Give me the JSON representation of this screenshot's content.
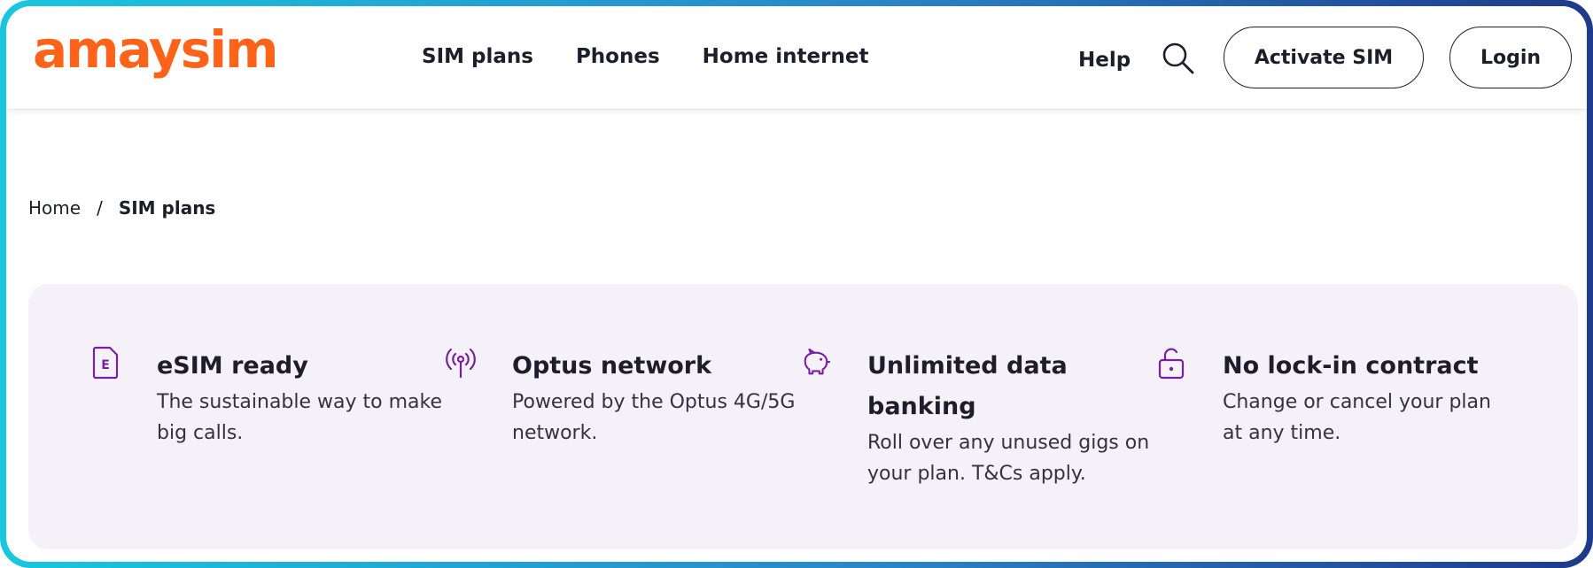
{
  "brand": {
    "logo_text": "amaysim",
    "accent_color": "#ff6319",
    "icon_color": "#7b1fa2"
  },
  "nav": {
    "items": [
      {
        "label": "SIM plans"
      },
      {
        "label": "Phones"
      },
      {
        "label": "Home internet"
      }
    ],
    "help_label": "Help",
    "search_icon": "search-icon",
    "activate_label": "Activate SIM",
    "login_label": "Login"
  },
  "breadcrumb": {
    "home": "Home",
    "separator": "/",
    "current": "SIM plans"
  },
  "features": [
    {
      "icon": "esim-icon",
      "icon_text": "E",
      "title": "eSIM ready",
      "desc": "The sustainable way to make big calls."
    },
    {
      "icon": "network-signal-icon",
      "title": "Optus network",
      "desc": "Powered by the Optus 4G/5G network."
    },
    {
      "icon": "piggy-bank-icon",
      "title": "Unlimited data banking",
      "desc": "Roll over any unused gigs on your plan. T&Cs apply."
    },
    {
      "icon": "unlocked-padlock-icon",
      "title": "No lock-in contract",
      "desc": "Change or cancel your plan at any time."
    }
  ]
}
